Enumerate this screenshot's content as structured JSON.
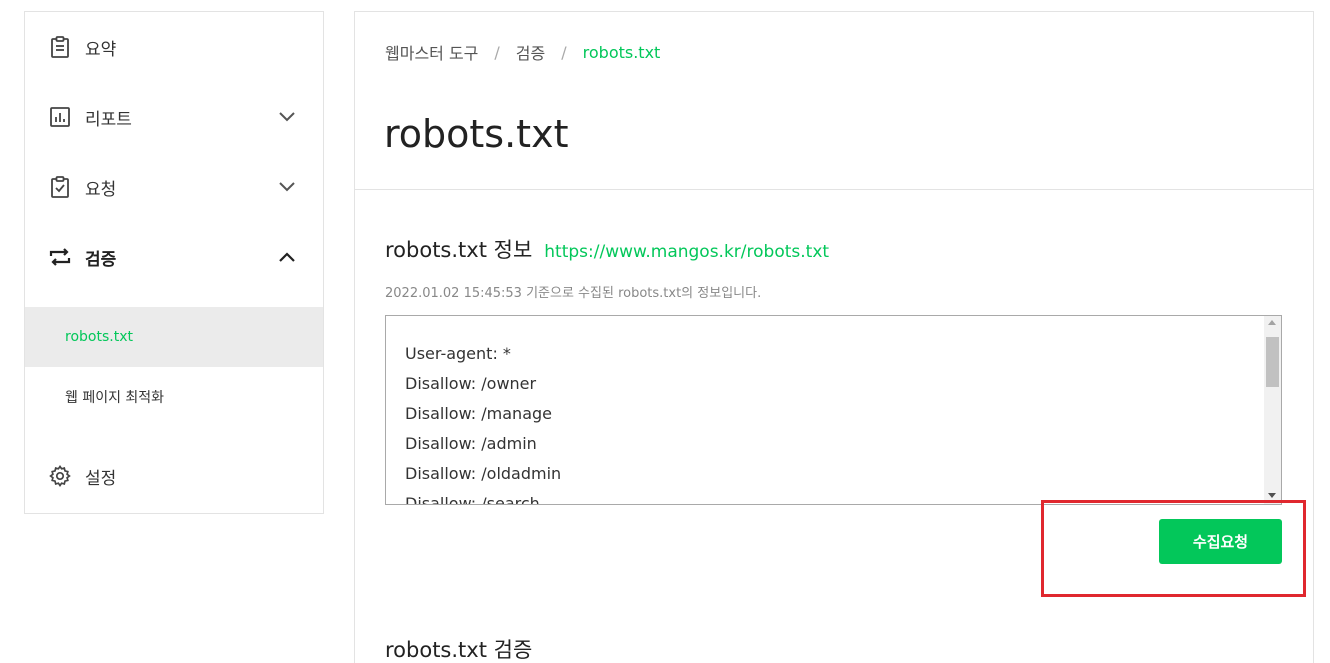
{
  "sidebar": {
    "items": [
      {
        "label": "요약",
        "icon": "clipboard-icon"
      },
      {
        "label": "리포트",
        "icon": "bar-chart-icon"
      },
      {
        "label": "요청",
        "icon": "clipboard-check-icon"
      },
      {
        "label": "검증",
        "icon": "repeat-icon"
      },
      {
        "label": "설정",
        "icon": "gear-icon"
      }
    ],
    "sub_items": [
      {
        "label": "robots.txt"
      },
      {
        "label": "웹 페이지 최적화"
      }
    ]
  },
  "breadcrumb": {
    "items": [
      "웹마스터 도구",
      "검증",
      "robots.txt"
    ],
    "separator": "/"
  },
  "page_title": "robots.txt",
  "info_section": {
    "title": "robots.txt 정보",
    "link": "https://www.mangos.kr/robots.txt",
    "info": "2022.01.02 15:45:53 기준으로 수집된 robots.txt의 정보입니다.",
    "lines": [
      "User-agent: *",
      "Disallow: /owner",
      "Disallow: /manage",
      "Disallow: /admin",
      "Disallow: /oldadmin",
      "Disallow: /search"
    ],
    "button_label": "수집요청"
  },
  "verify_section": {
    "title": "robots.txt 검증"
  },
  "colors": {
    "accent": "#03c75a",
    "highlight": "#e0282e"
  }
}
